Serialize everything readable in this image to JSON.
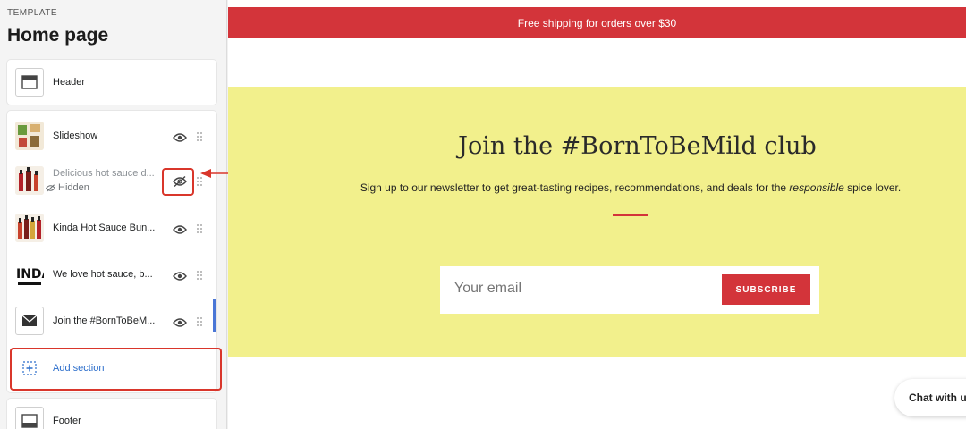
{
  "sidebar": {
    "template_label": "TEMPLATE",
    "page_title": "Home page",
    "header_item": {
      "label": "Header"
    },
    "sections": [
      {
        "label": "Slideshow",
        "icon": "slideshow-thumb"
      },
      {
        "label": "Delicious hot sauce d...",
        "icon": "hot-sauce-thumb",
        "status": "Hidden"
      },
      {
        "label": "Kinda Hot Sauce Bun...",
        "icon": "hot-sauce-thumb"
      },
      {
        "label": "We love hot sauce, b...",
        "icon": "kinda-logo-thumb"
      },
      {
        "label": "Join the #BornToBeM...",
        "icon": "mail-icon"
      }
    ],
    "add_section_label": "Add section",
    "footer_item": {
      "label": "Footer"
    }
  },
  "preview": {
    "announcement": "Free shipping for orders over $30",
    "newsletter": {
      "title": "Join the #BornToBeMild club",
      "subtitle_before": "Sign up to our newsletter to get great-tasting recipes, recommendations, and deals for the ",
      "subtitle_em": "responsible",
      "subtitle_after": " spice lover.",
      "email_placeholder": "Your email",
      "subscribe_label": "SUBSCRIBE"
    },
    "chat_label": "Chat with u"
  },
  "colors": {
    "accent_red": "#d3343a",
    "banner_yellow": "#f2f08c",
    "highlight": "#d9362b",
    "link_blue": "#2c6ecb"
  }
}
